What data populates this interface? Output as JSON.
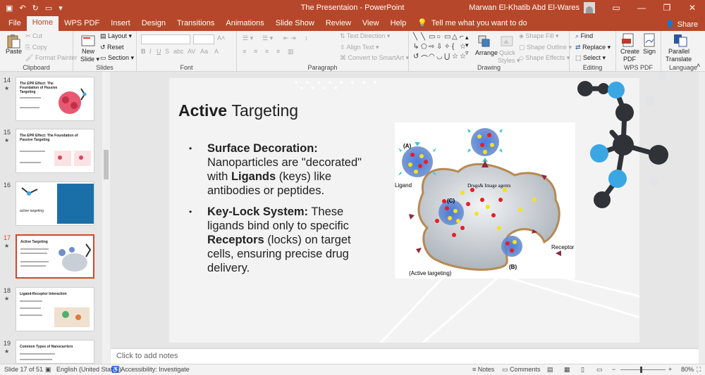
{
  "window": {
    "title": "The Presentaion  -  PowerPoint",
    "user": "Marwan El-Khatib Abd El-Wares"
  },
  "menu": {
    "tabs": [
      "File",
      "Home",
      "WPS PDF",
      "Insert",
      "Design",
      "Transitions",
      "Animations",
      "Slide Show",
      "Review",
      "View",
      "Help"
    ],
    "active": "Home",
    "tell_me": "Tell me what you want to do",
    "share": "Share"
  },
  "ribbon": {
    "clipboard": {
      "label": "Clipboard",
      "paste": "Paste",
      "cut": "Cut",
      "copy": "Copy",
      "format_painter": "Format Painter"
    },
    "slides": {
      "label": "Slides",
      "new_slide": "New",
      "new_slide_2": "Slide",
      "layout": "Layout",
      "reset": "Reset",
      "section": "Section"
    },
    "font": {
      "label": "Font"
    },
    "paragraph": {
      "label": "Paragraph",
      "text_direction": "Text Direction",
      "align_text": "Align Text",
      "smartart": "Convert to SmartArt"
    },
    "drawing": {
      "label": "Drawing",
      "arrange": "Arrange",
      "quick_styles": "Quick",
      "quick_styles_2": "Styles",
      "shape_fill": "Shape Fill",
      "shape_outline": "Shape Outline",
      "shape_effects": "Shape Effects"
    },
    "editing": {
      "label": "Editing",
      "find": "Find",
      "replace": "Replace",
      "select": "Select"
    },
    "wps_pdf": {
      "label": "WPS PDF",
      "create_pdf": "Create",
      "create_pdf_2": "PDF",
      "sign": "Sign"
    },
    "language": {
      "label": "Language",
      "parallel": "Parallel",
      "translate": "Translate"
    }
  },
  "thumbnails": [
    {
      "num": "14",
      "title": "The EPR Effect: The Foundation of Passive Targeting"
    },
    {
      "num": "15",
      "title": "The EPR Effect: The Foundation of Passive Targeting"
    },
    {
      "num": "16",
      "title": "active targeting"
    },
    {
      "num": "17",
      "title": "Active Targeting"
    },
    {
      "num": "18",
      "title": "Ligand-Receptor Interaction"
    },
    {
      "num": "19",
      "title": "Common Types of Nanocarriers"
    }
  ],
  "slide": {
    "title_part1": "Active ",
    "title_part2": "Targeting",
    "bullet1": {
      "bold": "Surface Decoration:",
      "text1": " Nanoparticles are \"decorated\" with ",
      "bold2": "Ligands",
      "text2": " (keys) like antibodies or peptides."
    },
    "bullet2": {
      "bold": "Key-Lock System:",
      "text1": " These ligands bind only to specific ",
      "bold2": "Receptors",
      "text2": " (locks) on target cells, ensuring precise drug delivery."
    },
    "figure": {
      "label_a": "(A)",
      "label_b": "(B)",
      "label_c": "(C)",
      "ligand": "Ligand",
      "drugs": "Drugs& Image agents",
      "receptor": "Receptor",
      "caption": "(Active targeting)"
    }
  },
  "notes": {
    "placeholder": "Click to add notes"
  },
  "status": {
    "slide_of": "Slide 17 of 51",
    "language": "English (United States)",
    "accessibility": "Accessibility: Investigate",
    "notes": "Notes",
    "comments": "Comments",
    "zoom": "80%"
  },
  "colors": {
    "accent": "#b7472a",
    "active_thumb": "#d24726",
    "molecule_dark": "#2f3236",
    "molecule_blue": "#3aa7e3"
  }
}
